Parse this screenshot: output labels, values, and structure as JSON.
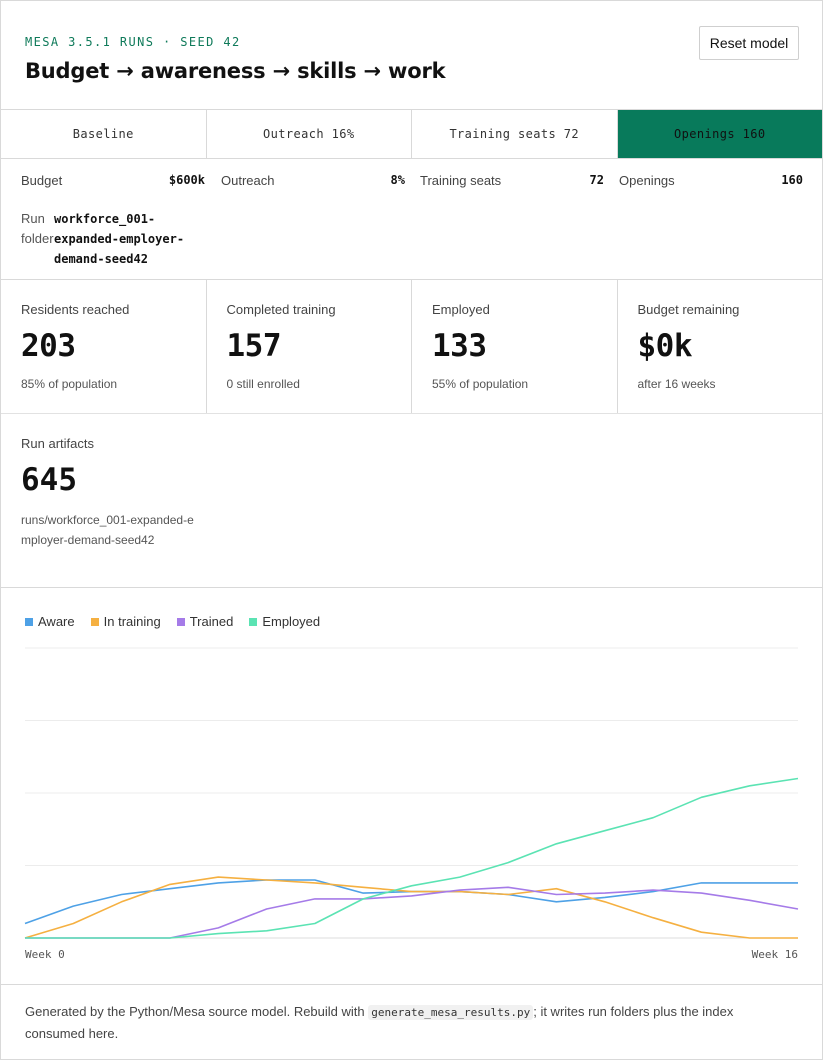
{
  "header": {
    "eyebrow": "MESA 3.5.1 RUNS · SEED 42",
    "title": "Budget → awareness → skills → work",
    "reset_label": "Reset model"
  },
  "tabs": [
    {
      "label": "Baseline",
      "active": false
    },
    {
      "label": "Outreach 16%",
      "active": false
    },
    {
      "label": "Training seats 72",
      "active": false
    },
    {
      "label": "Openings 160",
      "active": true
    }
  ],
  "params": {
    "budget": {
      "label": "Budget",
      "value": "$600k"
    },
    "outreach": {
      "label": "Outreach",
      "value": "8%"
    },
    "training_seats": {
      "label": "Training seats",
      "value": "72"
    },
    "openings": {
      "label": "Openings",
      "value": "160"
    },
    "run_folder": {
      "label": "Run folder",
      "value": "workforce_001-expanded-employer-demand-seed42"
    }
  },
  "stats": [
    {
      "label": "Residents reached",
      "value": "203",
      "sub": "85% of population"
    },
    {
      "label": "Completed training",
      "value": "157",
      "sub": "0 still enrolled"
    },
    {
      "label": "Employed",
      "value": "133",
      "sub": "55% of population"
    },
    {
      "label": "Budget remaining",
      "value": "$0k",
      "sub": "after 16 weeks"
    }
  ],
  "artifacts": {
    "label": "Run artifacts",
    "value": "645",
    "sub": "runs/workforce_001-expanded-employer-demand-seed42"
  },
  "chart_data": {
    "type": "line",
    "x": [
      0,
      1,
      2,
      3,
      4,
      5,
      6,
      7,
      8,
      9,
      10,
      11,
      12,
      13,
      14,
      15,
      16
    ],
    "x_start_label": "Week 0",
    "x_end_label": "Week 16",
    "ylim": [
      0,
      200
    ],
    "grid": true,
    "legend": "top-left",
    "series": [
      {
        "name": "Aware",
        "color": "#4ea1e6",
        "values": [
          10,
          22,
          30,
          34,
          38,
          40,
          40,
          31,
          32,
          32,
          30,
          25,
          28,
          32,
          38,
          38,
          38
        ]
      },
      {
        "name": "In training",
        "color": "#f5b041",
        "values": [
          0,
          10,
          25,
          37,
          42,
          40,
          38,
          35,
          32,
          32,
          30,
          34,
          25,
          14,
          4,
          0,
          0
        ]
      },
      {
        "name": "Trained",
        "color": "#a57be8",
        "values": [
          0,
          0,
          0,
          0,
          7,
          20,
          27,
          27,
          29,
          33,
          35,
          30,
          31,
          33,
          31,
          26,
          20
        ]
      },
      {
        "name": "Employed",
        "color": "#5be3b3",
        "values": [
          0,
          0,
          0,
          0,
          3,
          5,
          10,
          27,
          36,
          42,
          52,
          65,
          74,
          83,
          97,
          105,
          110
        ]
      }
    ]
  },
  "footer": {
    "before": "Generated by the Python/Mesa source model. Rebuild with",
    "code": "generate_mesa_results.py",
    "after": "; it writes run folders plus the index consumed here."
  }
}
